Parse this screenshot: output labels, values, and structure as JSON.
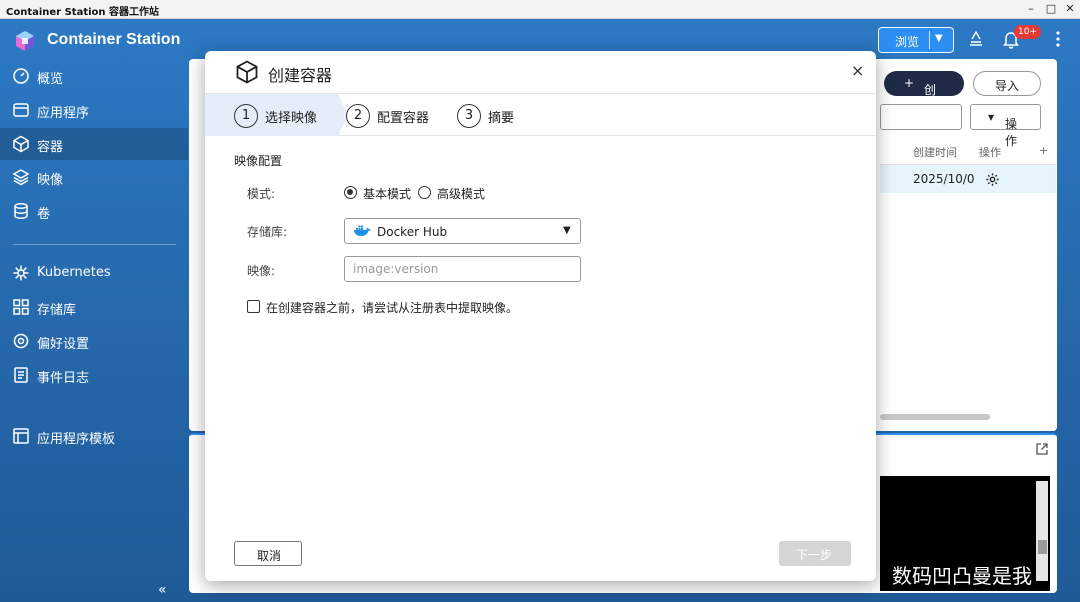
{
  "window": {
    "title": "Container Station 容器工作站",
    "minimize": "–",
    "maximize": "□",
    "close": "✕"
  },
  "app": {
    "name": "Container Station"
  },
  "header": {
    "browse_label": "浏览",
    "notification_badge": "10+",
    "icons": [
      "stack-icon",
      "bell-icon",
      "more-vertical-icon"
    ]
  },
  "sidebar": {
    "items": [
      {
        "label": "概览",
        "icon": "dashboard-icon"
      },
      {
        "label": "应用程序",
        "icon": "apps-icon"
      },
      {
        "label": "容器",
        "icon": "container-cube-icon",
        "active": true
      },
      {
        "label": "映像",
        "icon": "layers-icon"
      },
      {
        "label": "卷",
        "icon": "database-icon"
      },
      {
        "label": "Kubernetes",
        "icon": "helm-icon"
      },
      {
        "label": "存储库",
        "icon": "grid-icon"
      },
      {
        "label": "偏好设置",
        "icon": "settings-icon"
      },
      {
        "label": "事件日志",
        "icon": "log-icon"
      },
      {
        "label": "应用程序模板",
        "icon": "template-icon"
      }
    ],
    "collapse": "«"
  },
  "background_page": {
    "create_label": "创建",
    "import_label": "导入",
    "operations_label": "操作",
    "table": {
      "headers": [
        "创建时间",
        "操作",
        "+"
      ],
      "rows": [
        {
          "created": "2025/10/0"
        }
      ]
    }
  },
  "dialog": {
    "title": "创建容器",
    "close": "×",
    "steps": [
      {
        "num": "1",
        "label": "选择映像",
        "active": true
      },
      {
        "num": "2",
        "label": "配置容器"
      },
      {
        "num": "3",
        "label": "摘要"
      }
    ],
    "section_title": "映像配置",
    "mode": {
      "label": "模式:",
      "options": [
        "基本模式",
        "高级模式"
      ],
      "selected": "基本模式"
    },
    "registry": {
      "label": "存储库:",
      "value": "Docker Hub"
    },
    "image": {
      "label": "映像:",
      "value": "",
      "placeholder": "image:version"
    },
    "pull_checkbox": {
      "label": "在创建容器之前，请尝试从注册表中提取映像。",
      "checked": false
    },
    "cancel_label": "取消",
    "next_label": "下一步"
  },
  "watermark": "数码凹凸曼是我",
  "colors": {
    "sidebar_bg": "#2a6fb1",
    "primary": "#2b8ef0",
    "create_btn": "#1f2b46",
    "step_active": "#e4edf8"
  }
}
